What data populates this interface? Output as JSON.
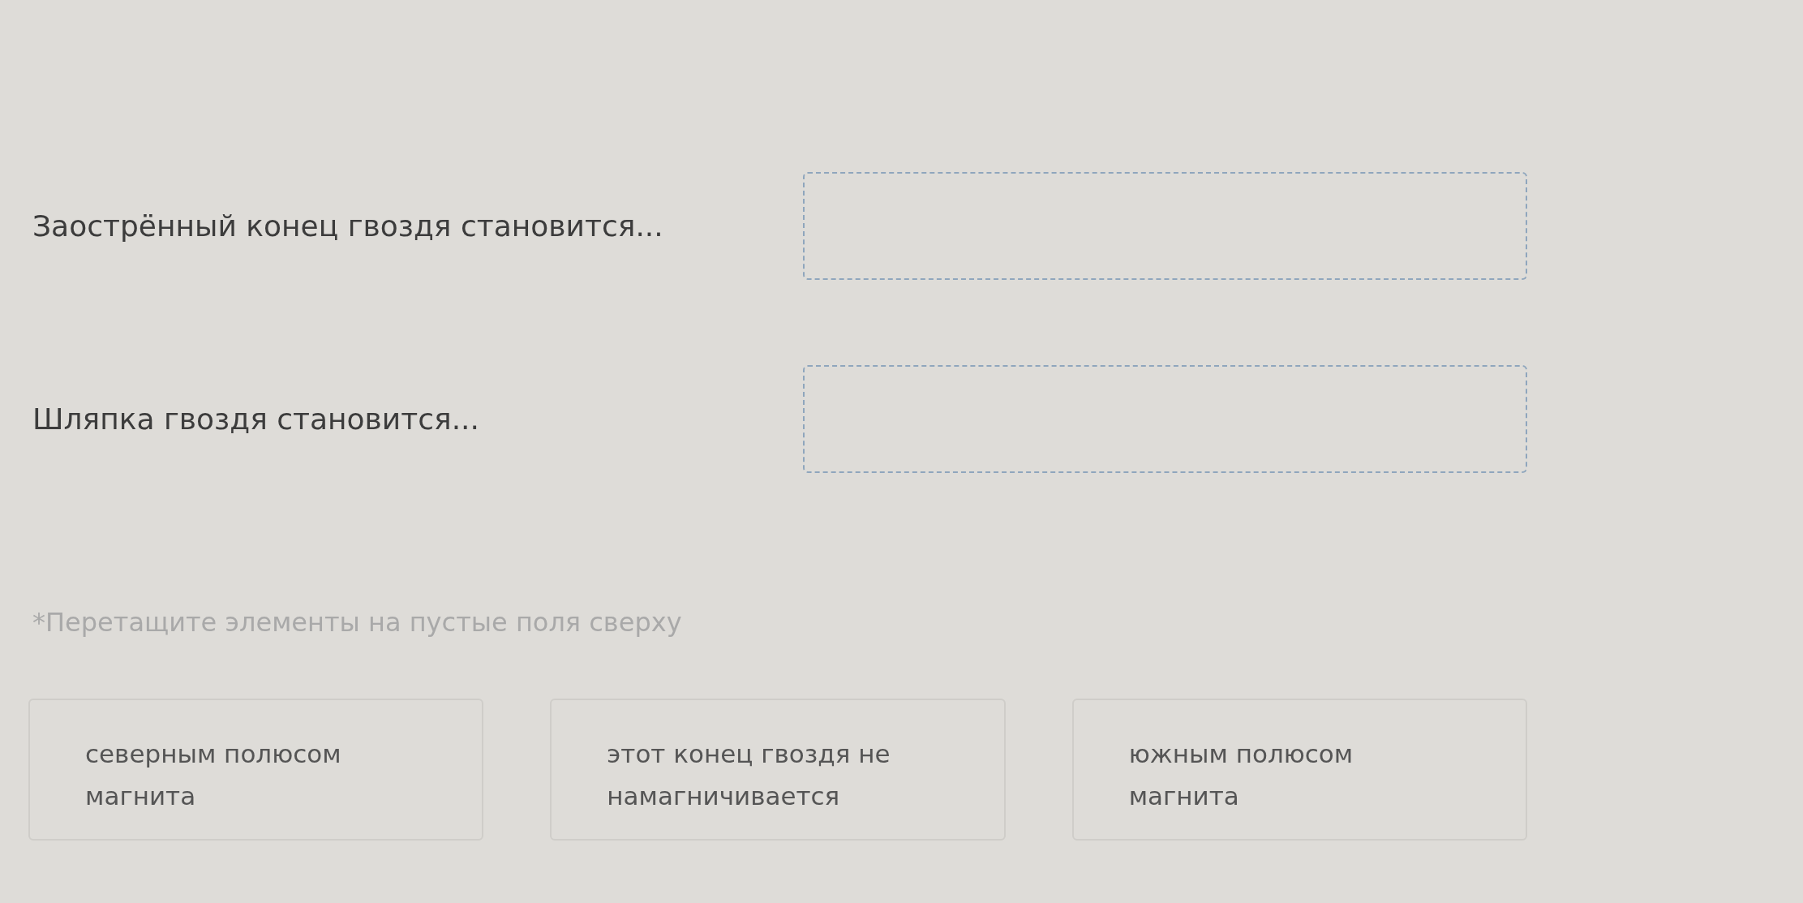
{
  "questions": [
    {
      "text": "Заострённый конец гвоздя становится..."
    },
    {
      "text": "Шляпка гвоздя становится..."
    }
  ],
  "hint": "*Перетащите элементы на пустые поля сверху",
  "options": [
    {
      "text": "северным полюсом магнита"
    },
    {
      "text": "этот конец гвоздя не намагничивается"
    },
    {
      "text": "южным полюсом магнита"
    }
  ]
}
